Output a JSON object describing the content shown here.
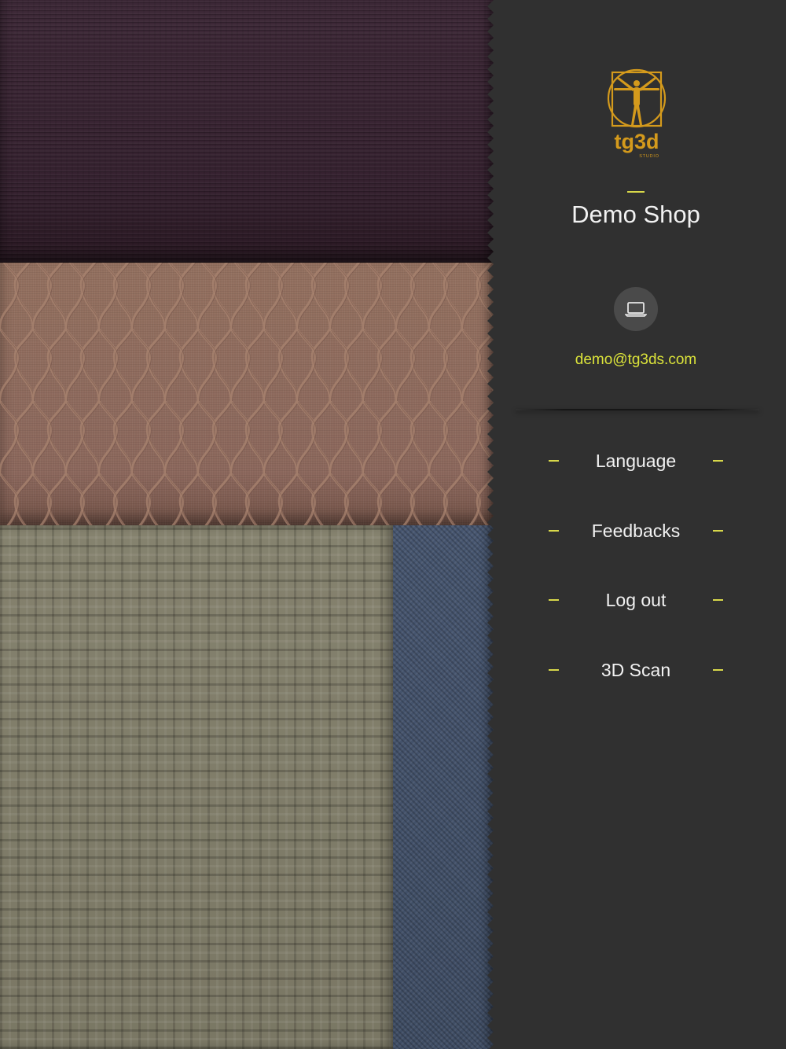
{
  "shop": {
    "name": "Demo Shop",
    "email": "demo@tg3ds.com"
  },
  "logo": {
    "text": "tg3d",
    "subtext": "STUDIO",
    "icon": "vitruvian-man-icon",
    "color": "#d49a1c"
  },
  "device_icon": "laptop-icon",
  "menu": {
    "items": [
      {
        "label": "Language"
      },
      {
        "label": "Feedbacks"
      },
      {
        "label": "Log out"
      },
      {
        "label": "3D Scan"
      }
    ]
  },
  "colors": {
    "accent": "#d8d84a",
    "email": "#dbe33a",
    "panel": "#303030",
    "fabric_purple": "#3a2533",
    "fabric_pink": "#8e6a5f",
    "fabric_olive": "#7e7b68",
    "fabric_blue": "#44536b"
  }
}
